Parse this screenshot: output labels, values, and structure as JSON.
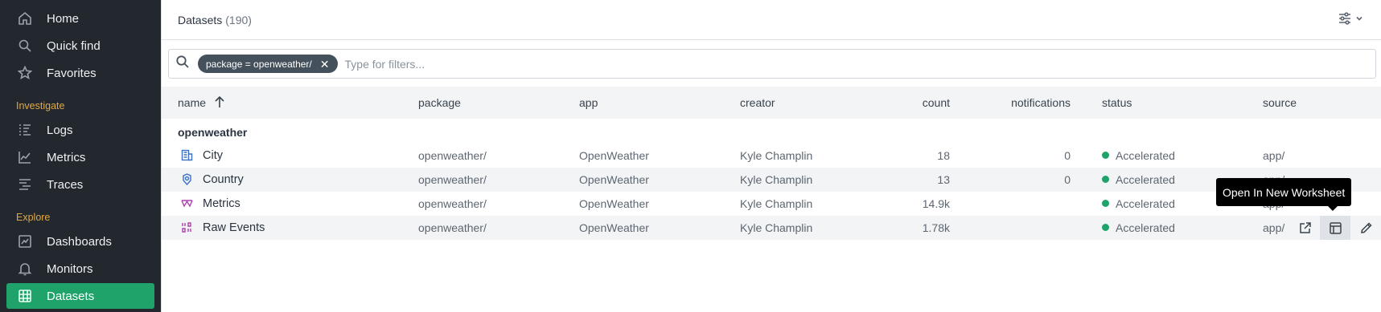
{
  "sidebar": {
    "items": [
      {
        "label": "Home",
        "icon": "home-icon"
      },
      {
        "label": "Quick find",
        "icon": "search-icon"
      },
      {
        "label": "Favorites",
        "icon": "star-icon"
      }
    ],
    "investigate_label": "Investigate",
    "investigate_items": [
      {
        "label": "Logs",
        "icon": "logs-icon"
      },
      {
        "label": "Metrics",
        "icon": "metrics-icon"
      },
      {
        "label": "Traces",
        "icon": "traces-icon"
      }
    ],
    "explore_label": "Explore",
    "explore_items": [
      {
        "label": "Dashboards",
        "icon": "dashboard-icon"
      },
      {
        "label": "Monitors",
        "icon": "bell-icon"
      },
      {
        "label": "Datasets",
        "icon": "grid-icon",
        "active": true
      }
    ],
    "active_color": "#1fa36a"
  },
  "header": {
    "title": "Datasets",
    "count": "(190)"
  },
  "filter": {
    "chip_label": "package = openweather/",
    "placeholder": "Type for filters..."
  },
  "table": {
    "columns": {
      "name": "name",
      "package": "package",
      "app": "app",
      "creator": "creator",
      "count": "count",
      "notifications": "notifications",
      "status": "status",
      "source": "source"
    },
    "group": "openweather",
    "rows": [
      {
        "name": "City",
        "package": "openweather/",
        "app": "OpenWeather",
        "creator": "Kyle Champlin",
        "count": "18",
        "notifications": "0",
        "status": "Accelerated",
        "source": "app/",
        "icon": "table-icon"
      },
      {
        "name": "Country",
        "package": "openweather/",
        "app": "OpenWeather",
        "creator": "Kyle Champlin",
        "count": "13",
        "notifications": "0",
        "status": "Accelerated",
        "source": "app/",
        "icon": "resource-icon"
      },
      {
        "name": "Metrics",
        "package": "openweather/",
        "app": "OpenWeather",
        "creator": "Kyle Champlin",
        "count": "14.9k",
        "notifications": "",
        "status": "Accelerated",
        "source": "app/",
        "icon": "metrics-icon"
      },
      {
        "name": "Raw Events",
        "package": "openweather/",
        "app": "OpenWeather",
        "creator": "Kyle Champlin",
        "count": "1.78k",
        "notifications": "",
        "status": "Accelerated",
        "source": "app/",
        "icon": "event-icon"
      }
    ],
    "status_color": "#1fa36a"
  },
  "tooltip": {
    "text": "Open In New Worksheet"
  }
}
